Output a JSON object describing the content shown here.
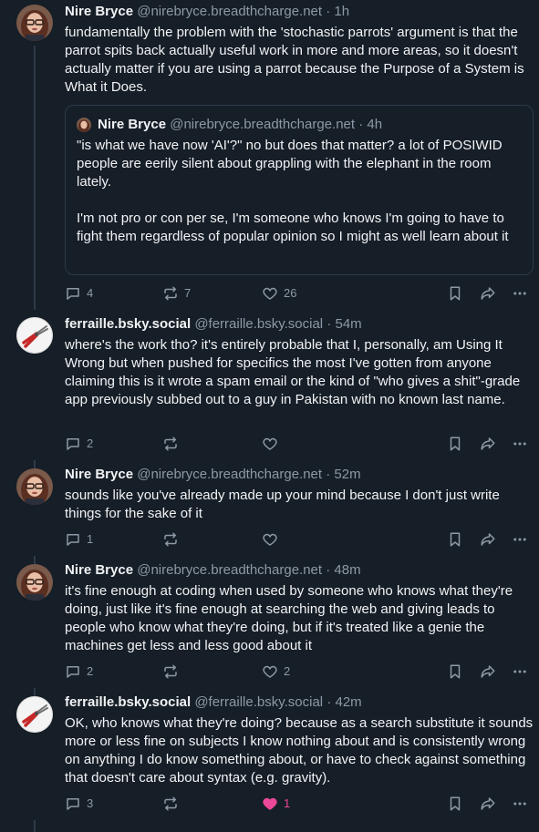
{
  "posts": [
    {
      "name": "Nire Bryce",
      "handle": "@nirebryce.breadthcharge.net",
      "time": "1h",
      "text": "fundamentally the problem with the 'stochastic parrots' argument is that the parrot spits back actually useful work in more and more areas, so it doesn't actually matter if you are using a parrot because the Purpose of a System is What it Does.",
      "quote": {
        "name": "Nire Bryce",
        "handle": "@nirebryce.breadthcharge.net",
        "time": "4h",
        "text": "\"is what we have now 'AI'?\" no but does that matter? a lot of POSIWID people are eerily silent about grappling with the elephant in the room lately.\n\nI'm not pro or con per se, I'm someone who knows I'm going to have to fight them regardless of popular opinion so I might as well learn about it"
      },
      "replies": "4",
      "reposts": "7",
      "likes": "26"
    },
    {
      "name": "ferraille.bsky.social",
      "handle": "@ferraille.bsky.social",
      "time": "54m",
      "text": "where's the work tho? it's entirely probable that I, personally, am Using It Wrong but when pushed for specifics the most I've gotten from anyone claiming this is it wrote a spam email or the kind of \"who gives a shit\"-grade app previously subbed out to a guy in Pakistan with no known last name.",
      "replies": "2",
      "reposts": "",
      "likes": ""
    },
    {
      "name": "Nire Bryce",
      "handle": "@nirebryce.breadthcharge.net",
      "time": "52m",
      "text": "sounds like you've already made up your mind because I don't just write things for the sake of it",
      "replies": "1",
      "reposts": "",
      "likes": ""
    },
    {
      "name": "Nire Bryce",
      "handle": "@nirebryce.breadthcharge.net",
      "time": "48m",
      "text": "it's fine enough at coding when used by someone who knows what they're doing, just like it's fine enough at searching the web and giving leads to people who know what they're doing, but if it's treated like a genie the machines get less and less good about it",
      "replies": "2",
      "reposts": "",
      "likes": "2"
    },
    {
      "name": "ferraille.bsky.social",
      "handle": "@ferraille.bsky.social",
      "time": "42m",
      "text": "OK, who knows what they're doing? because as a search substitute it sounds more or less fine on subjects I know nothing about and is consistently wrong on anything I do know something about, or have to check against something that doesn't care about syntax (e.g. gravity).",
      "replies": "3",
      "reposts": "",
      "likes": "1"
    }
  ],
  "separator": "·",
  "colors": {
    "background": "#161e27",
    "muted": "#8d99a6",
    "liked": "#ec4899",
    "border": "#2e3a48"
  },
  "icons": [
    "reply-icon",
    "repost-icon",
    "like-icon",
    "bookmark-icon",
    "share-icon",
    "more-icon"
  ]
}
